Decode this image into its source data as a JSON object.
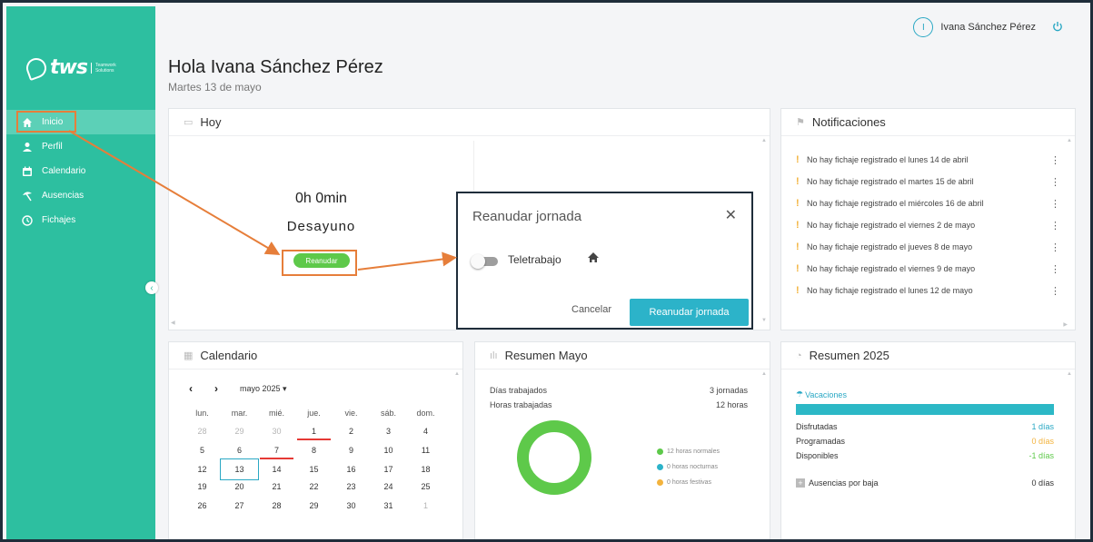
{
  "sidebar": {
    "logo_text": "tws",
    "logo_sub": [
      "Teamwork",
      "Solutions"
    ],
    "items": [
      {
        "label": "Inicio",
        "icon": "home-icon"
      },
      {
        "label": "Perfil",
        "icon": "user-icon"
      },
      {
        "label": "Calendario",
        "icon": "calendar-icon"
      },
      {
        "label": "Ausencias",
        "icon": "beach-umbrella-icon"
      },
      {
        "label": "Fichajes",
        "icon": "clock-icon"
      }
    ]
  },
  "header": {
    "user_name": "Ivana Sánchez Pérez",
    "user_initial": "I",
    "greeting": "Hola Ivana Sánchez Pérez",
    "date": "Martes 13 de mayo"
  },
  "hoy": {
    "title": "Hoy",
    "time": "0h 0min",
    "task": "Desayuno",
    "resume_button": "Reanudar"
  },
  "notificaciones": {
    "title": "Notificaciones",
    "items": [
      "No hay fichaje registrado el lunes 14 de abril",
      "No hay fichaje registrado el martes 15 de abril",
      "No hay fichaje registrado el miércoles 16 de abril",
      "No hay fichaje registrado el viernes 2 de mayo",
      "No hay fichaje registrado el jueves 8 de mayo",
      "No hay fichaje registrado el viernes 9 de mayo",
      "No hay fichaje registrado el lunes 12 de mayo"
    ]
  },
  "calendario": {
    "title": "Calendario",
    "month": "mayo 2025",
    "weekdays": [
      "lun.",
      "mar.",
      "mié.",
      "jue.",
      "vie.",
      "sáb.",
      "dom."
    ],
    "weeks": [
      [
        "28",
        "29",
        "30",
        "1",
        "2",
        "3",
        "4"
      ],
      [
        "5",
        "6",
        "7",
        "8",
        "9",
        "10",
        "11"
      ],
      [
        "12",
        "13",
        "14",
        "15",
        "16",
        "17",
        "18"
      ],
      [
        "19",
        "20",
        "21",
        "22",
        "23",
        "24",
        "25"
      ],
      [
        "26",
        "27",
        "28",
        "29",
        "30",
        "31",
        "1"
      ]
    ]
  },
  "resumen_mayo": {
    "title": "Resumen Mayo",
    "dias_label": "Días trabajados",
    "dias_value": "3 jornadas",
    "horas_label": "Horas trabajadas",
    "horas_value": "12 horas",
    "legend": [
      {
        "label": "12 horas normales",
        "color": "#5ec94a"
      },
      {
        "label": "0 horas nocturnas",
        "color": "#2cb3c9"
      },
      {
        "label": "0 horas festivas",
        "color": "#f3b33d"
      }
    ]
  },
  "resumen_2025": {
    "title": "Resumen 2025",
    "vacaciones_label": "Vacaciones",
    "stats": [
      {
        "label": "Disfrutadas",
        "value": "1 días",
        "color": "#2aa8c4"
      },
      {
        "label": "Programadas",
        "value": "0 días",
        "color": "#f3b33d"
      },
      {
        "label": "Disponibles",
        "value": "-1 días",
        "color": "#5ec94a"
      }
    ],
    "ausencias_label": "Ausencias por baja",
    "ausencias_value": "0 días"
  },
  "modal": {
    "title": "Reanudar jornada",
    "toggle_label": "Teletrabajo",
    "cancel": "Cancelar",
    "confirm": "Reanudar jornada"
  },
  "colors": {
    "sidebar": "#2dbfa0",
    "accent": "#2cb3c9",
    "success": "#5ec94a",
    "warning": "#f3b33d",
    "annotation": "#e67e3a"
  }
}
